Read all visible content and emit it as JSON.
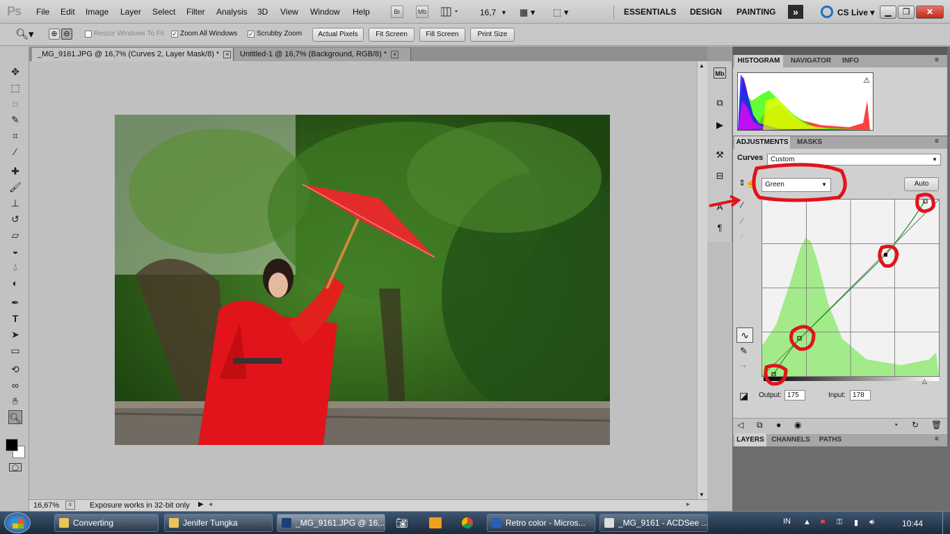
{
  "app": {
    "logo": "Ps"
  },
  "menu": [
    "File",
    "Edit",
    "Image",
    "Layer",
    "Select",
    "Filter",
    "Analysis",
    "3D",
    "View",
    "Window",
    "Help"
  ],
  "menubar_tools": {
    "bridge": "Br",
    "minibridge": "Mb",
    "zoom_value": "16,7"
  },
  "workspaces": [
    "ESSENTIALS",
    "DESIGN",
    "PAINTING"
  ],
  "cslive": "CS Live",
  "options": {
    "resize_windows": "Resize Windows To Fit",
    "zoom_all": "Zoom All Windows",
    "scrubby": "Scrubby Zoom",
    "actual_pixels": "Actual Pixels",
    "fit_screen": "Fit Screen",
    "fill_screen": "Fill Screen",
    "print_size": "Print Size"
  },
  "doc_tabs": [
    {
      "title": "_MG_9161.JPG @ 16,7% (Curves 2, Layer Mask/8) *",
      "active": true
    },
    {
      "title": "Untitled-1 @ 16,7% (Background, RGB/8) *",
      "active": false
    }
  ],
  "status": {
    "zoom": "16,67%",
    "message": "Exposure works in 32-bit only"
  },
  "panels": {
    "top_tabs": [
      "HISTOGRAM",
      "NAVIGATOR",
      "INFO"
    ],
    "adj_tabs": [
      "ADJUSTMENTS",
      "MASKS"
    ],
    "bottom_tabs": [
      "LAYERS",
      "CHANNELS",
      "PATHS"
    ],
    "mini_dock": {
      "mb_label": "Mb"
    }
  },
  "curves": {
    "title": "Curves",
    "preset": "Custom",
    "channel": "Green",
    "auto": "Auto",
    "output_label": "Output:",
    "output_value": "175",
    "input_label": "Input:",
    "input_value": "178"
  },
  "taskbar": [
    {
      "label": "Converting",
      "icon": "folder-icon"
    },
    {
      "label": "Jenifer Tungka",
      "icon": "folder-icon"
    },
    {
      "label": "_MG_9161.JPG @ 16,...",
      "icon": "photoshop-icon"
    },
    {
      "label": "Retro color - Micros...",
      "icon": "word-icon"
    },
    {
      "label": "_MG_9161 - ACDSee ...",
      "icon": "acdsee-icon"
    }
  ],
  "tray": {
    "lang": "IN",
    "time": "10:44"
  },
  "colors": {
    "accent_red": "#e0141a",
    "curve_green": "#8fe86e",
    "taskbar": "#2a3d52"
  }
}
